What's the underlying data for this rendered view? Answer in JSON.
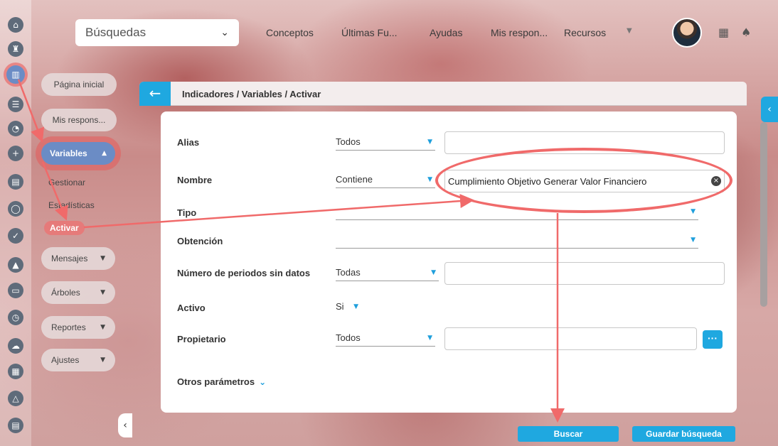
{
  "top": {
    "search_label": "Búsquedas",
    "nav": [
      "Conceptos",
      "Últimas Fu...",
      "Ayudas",
      "Mis respon...",
      "Recursos"
    ]
  },
  "rail_icons": [
    "home-icon",
    "tower-icon",
    "chart-icon",
    "menu-icon",
    "pie-icon",
    "plus-icon",
    "doc-icon",
    "circle-icon",
    "check-icon",
    "warning-icon",
    "screen-icon",
    "clock-icon",
    "cloud-icon",
    "calendar-icon",
    "network-icon",
    "list-icon"
  ],
  "menu": {
    "pagina_inicial": "Página inicial",
    "mis_respons": "Mis respons...",
    "variables": "Variables",
    "gestionar": "Gestionar",
    "estadisticas": "Estadísticas",
    "activar": "Activar",
    "mensajes": "Mensajes",
    "arboles": "Árboles",
    "reportes": "Reportes",
    "ajustes": "Ajustes"
  },
  "breadcrumb": "Indicadores / Variables / Activar",
  "form": {
    "alias": {
      "label": "Alias",
      "op": "Todos",
      "value": ""
    },
    "nombre": {
      "label": "Nombre",
      "op": "Contiene",
      "value": "Cumplimiento Objetivo Generar Valor Financiero"
    },
    "tipo": {
      "label": "Tipo",
      "value": ""
    },
    "obtencion": {
      "label": "Obtención",
      "value": ""
    },
    "periodos": {
      "label": "Número de periodos sin datos",
      "op": "Todas",
      "value": ""
    },
    "activo": {
      "label": "Activo",
      "value": "Si"
    },
    "propietario": {
      "label": "Propietario",
      "op": "Todos",
      "value": "",
      "more": "···"
    },
    "otros": "Otros parámetros"
  },
  "buttons": {
    "buscar": "Buscar",
    "guardar": "Guardar búsqueda"
  },
  "colors": {
    "accent": "#1fa8e0",
    "annotation": "#f06a6a",
    "menu_active": "#6b8cc5"
  }
}
